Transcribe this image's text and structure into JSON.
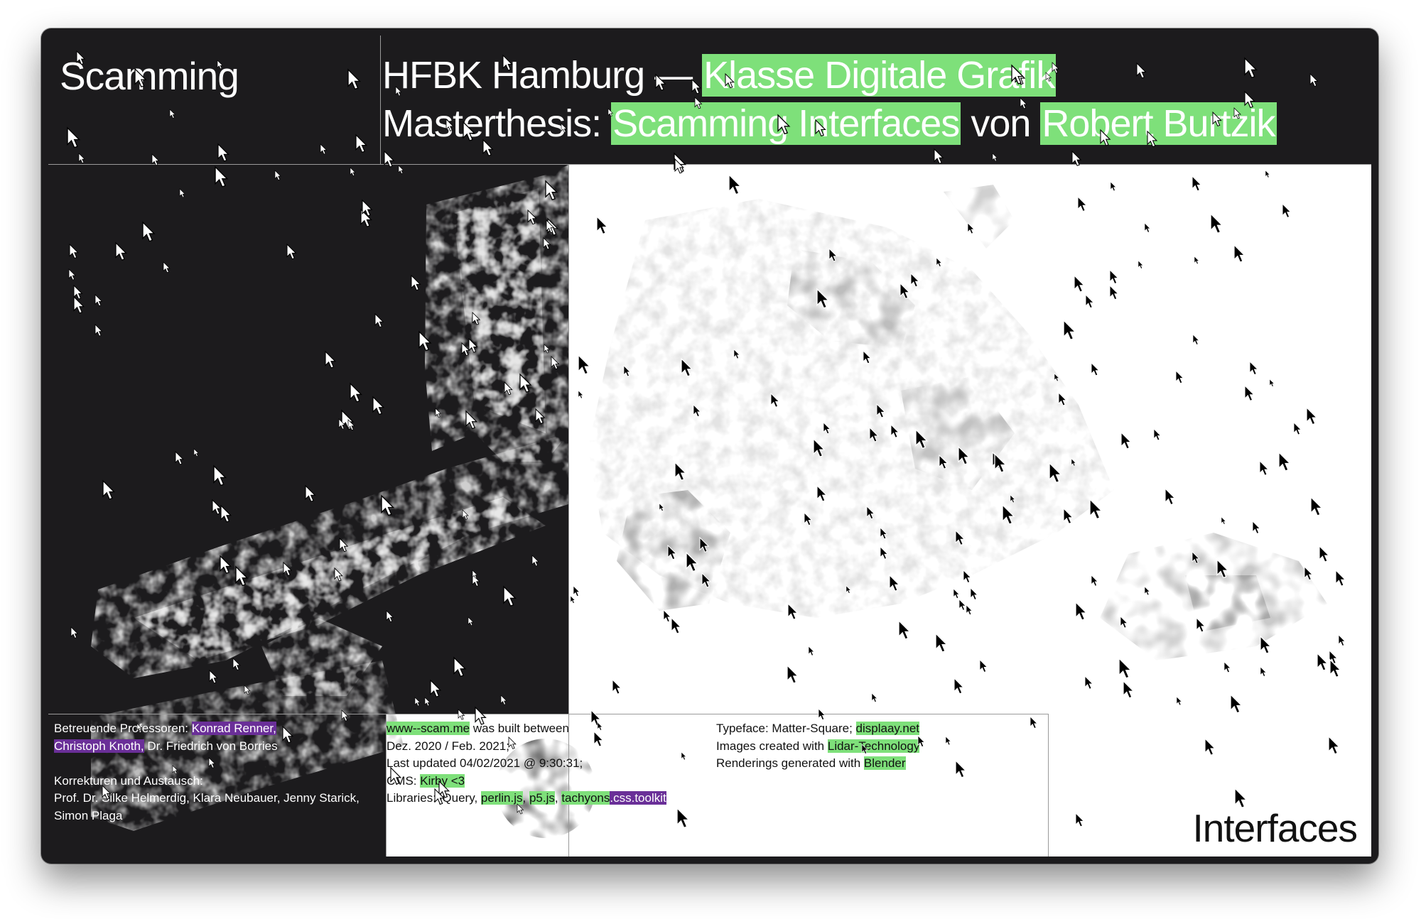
{
  "brand": {
    "left": "Scamming",
    "right": "Interfaces"
  },
  "header": {
    "line1_prefix": "HFBK Hamburg — ",
    "line1_highlight": "Klasse Digitale Grafik",
    "line2_prefix": "Masterthesis: ",
    "line2_highlight1": "Scamming Interfaces",
    "line2_middle": " von ",
    "line2_highlight2": "Robert Burtzik"
  },
  "credits": {
    "advisors_label": "Betreuende Professoren: ",
    "advisor1": "Konrad Renner,",
    "advisor2": "Christoph Knoth,",
    "advisor3": " Dr. Friedrich von Borries",
    "proof_label": "Korrekturen und Austausch:",
    "proof_names": "Prof. Dr. Silke Helmerdig, Klara Neubauer, Jenny Starick, Simon Plaga"
  },
  "build": {
    "site": "www--scam.me",
    "built_text": " was built between",
    "dates": "Dez. 2020 / Feb. 2021;",
    "updated": "Last updated 04/02/2021 @ 9:30:31;",
    "cms_label": "CMS: ",
    "cms_value": "Kirby <3",
    "libs_label": "Libraries: jQuery, ",
    "lib1": "perlin.js",
    "lib2": "p5.js",
    "lib3": "tachyons",
    "lib3b": ".css.toolkit"
  },
  "tech": {
    "typeface_label": "Typeface: Matter-Square; ",
    "typeface_source": "displaay.net",
    "images_label": "Images created with ",
    "images_tech": "Lidar-Technology",
    "render_label": "Renderings generated with ",
    "render_tool": "Blender"
  },
  "colors": {
    "accent_green": "#7ee07a",
    "accent_purple": "#6a2f98",
    "background_dark": "#1c1b1d"
  },
  "icons": {
    "cursor": "arrow-cursor-icon"
  }
}
